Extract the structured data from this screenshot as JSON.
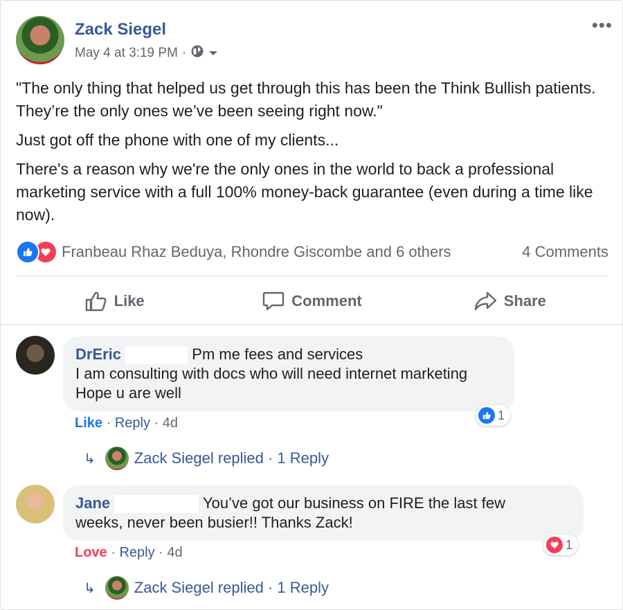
{
  "post": {
    "author": "Zack Siegel",
    "timestamp": "May 4 at 3:19 PM",
    "separator": "·",
    "privacy_icon": "globe-icon",
    "menu_icon": "more-options-icon",
    "paragraphs": [
      "\"The only thing that helped us get through this has been the Think Bullish patients. They’re the only ones we’ve been seeing right now.\"",
      "Just got off the phone with one of my clients...",
      "There's a reason why we're the only ones in the world to back a professional marketing service with a full 100% money-back guarantee (even during a time like now)."
    ],
    "reactions": {
      "names": "Franbeau Rhaz Beduya, Rhondre Giscombe and 6 others",
      "comments_count": "4 Comments",
      "icons": [
        "like-reaction-icon",
        "love-reaction-icon"
      ]
    },
    "actions": {
      "like": "Like",
      "comment": "Comment",
      "share": "Share"
    }
  },
  "comments": [
    {
      "name": "DrEric",
      "line1": "Pm me fees and services",
      "line2": "I am consulting with docs who will need internet marketing",
      "line3": "Hope u are well",
      "reaction_word": "Like",
      "reply_label": "Reply",
      "age": "4d",
      "reaction_count": "1",
      "replied_text": "Zack Siegel replied · 1 Reply"
    },
    {
      "name": "Jane",
      "line1": "You’ve got our business on FIRE the last few",
      "line2": "weeks, never been busier!! Thanks Zack!",
      "reaction_word": "Love",
      "reply_label": "Reply",
      "age": "4d",
      "reaction_count": "1",
      "replied_text": "Zack Siegel replied · 1 Reply"
    }
  ],
  "colors": {
    "link_blue": "#385898",
    "like_blue": "#1877f2",
    "love_red": "#f33e58",
    "meta_gray": "#606770",
    "bubble_gray": "#f2f3f5"
  }
}
